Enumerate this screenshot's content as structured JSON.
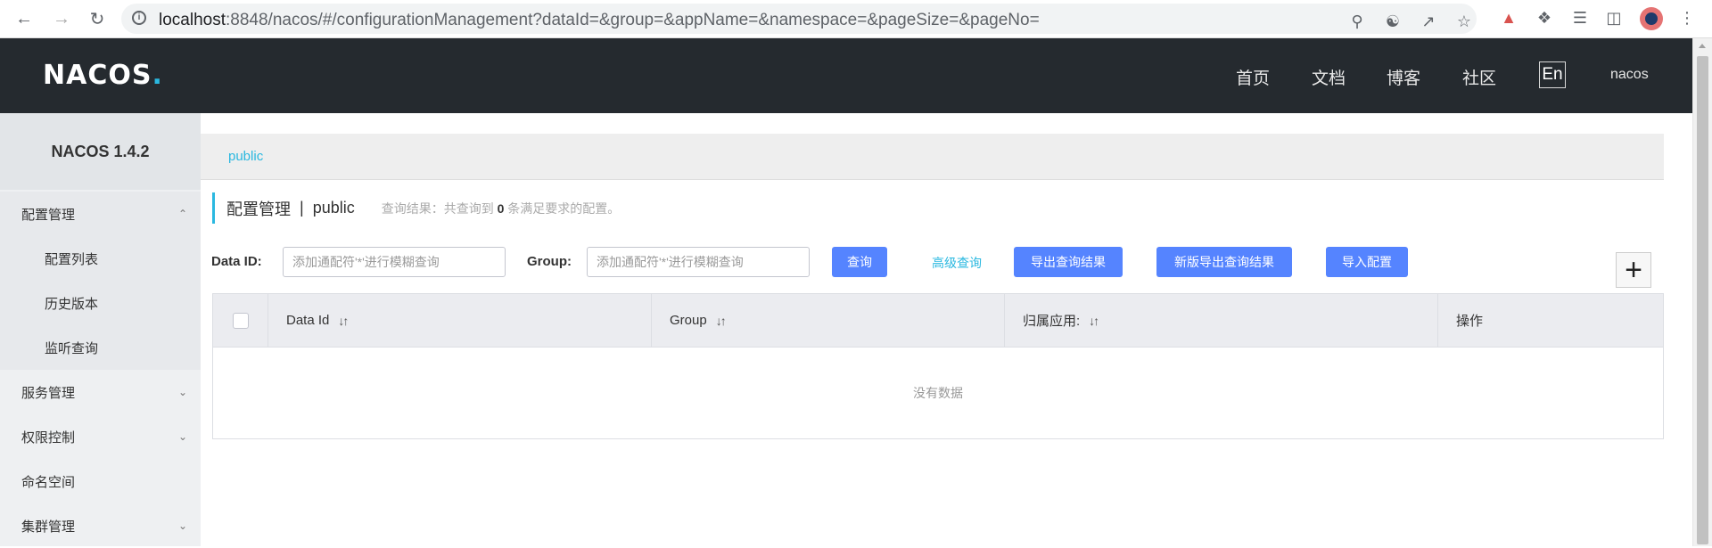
{
  "browser": {
    "url_host": "localhost",
    "url_rest": ":8848/nacos/#/configurationManagement?dataId=&group=&appName=&namespace=&pageSize=&pageNo="
  },
  "header": {
    "logo": "NACOS",
    "logo_dot": ".",
    "nav": [
      "首页",
      "文档",
      "博客",
      "社区"
    ],
    "lang": "En",
    "user": "nacos"
  },
  "sidebar": {
    "version": "NACOS 1.4.2",
    "items": [
      {
        "label": "配置管理",
        "expanded": true
      },
      {
        "label": "配置列表"
      },
      {
        "label": "历史版本"
      },
      {
        "label": "监听查询"
      },
      {
        "label": "服务管理"
      },
      {
        "label": "权限控制"
      },
      {
        "label": "命名空间"
      },
      {
        "label": "集群管理"
      }
    ]
  },
  "namespace": {
    "current": "public"
  },
  "page": {
    "title": "配置管理",
    "separator": "|",
    "namespace": "public",
    "hint_prefix": "查询结果：共查询到",
    "hint_count": "0",
    "hint_suffix": "条满足要求的配置。"
  },
  "filters": {
    "dataid_label": "Data ID:",
    "dataid_placeholder": "添加通配符'*'进行模糊查询",
    "group_label": "Group:",
    "group_placeholder": "添加通配符'*'进行模糊查询",
    "query_button": "查询",
    "advanced_link": "高级查询",
    "export_button": "导出查询结果",
    "new_export_button": "新版导出查询结果",
    "import_button": "导入配置",
    "add_symbol": "+"
  },
  "table": {
    "columns": [
      "Data Id",
      "Group",
      "归属应用:",
      "操作"
    ],
    "sort_symbol": "↓↑",
    "empty_text": "没有数据"
  },
  "colors": {
    "accent": "#2ab8e0",
    "primary_button": "#5584ff",
    "header_bg": "#252a2f",
    "sidebar_bg": "#eef0f2"
  }
}
